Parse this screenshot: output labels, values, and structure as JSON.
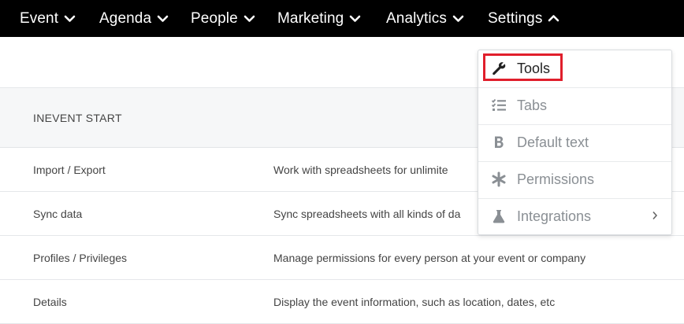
{
  "nav": {
    "items": [
      {
        "label": "Event"
      },
      {
        "label": "Agenda"
      },
      {
        "label": "People"
      },
      {
        "label": "Marketing"
      },
      {
        "label": "Analytics"
      },
      {
        "label": "Settings"
      }
    ]
  },
  "section": {
    "title": "INEVENT START"
  },
  "rows": [
    {
      "name": "Import / Export",
      "desc": "Work with spreadsheets for unlimite"
    },
    {
      "name": "Sync data",
      "desc": "Sync spreadsheets with all kinds of da"
    },
    {
      "name": "Profiles / Privileges",
      "desc": "Manage permissions for every person at your event or company"
    },
    {
      "name": "Details",
      "desc": "Display the event information, such as location, dates, etc"
    }
  ],
  "dropdown": {
    "items": [
      {
        "label": "Tools",
        "icon": "wrench-icon"
      },
      {
        "label": "Tabs",
        "icon": "checklist-icon"
      },
      {
        "label": "Default text",
        "icon": "bold-icon"
      },
      {
        "label": "Permissions",
        "icon": "asterisk-icon"
      },
      {
        "label": "Integrations",
        "icon": "flask-icon"
      }
    ]
  },
  "colors": {
    "nav_bg": "#000000",
    "highlight": "#e01e2b",
    "muted_text": "#8a8f94"
  }
}
